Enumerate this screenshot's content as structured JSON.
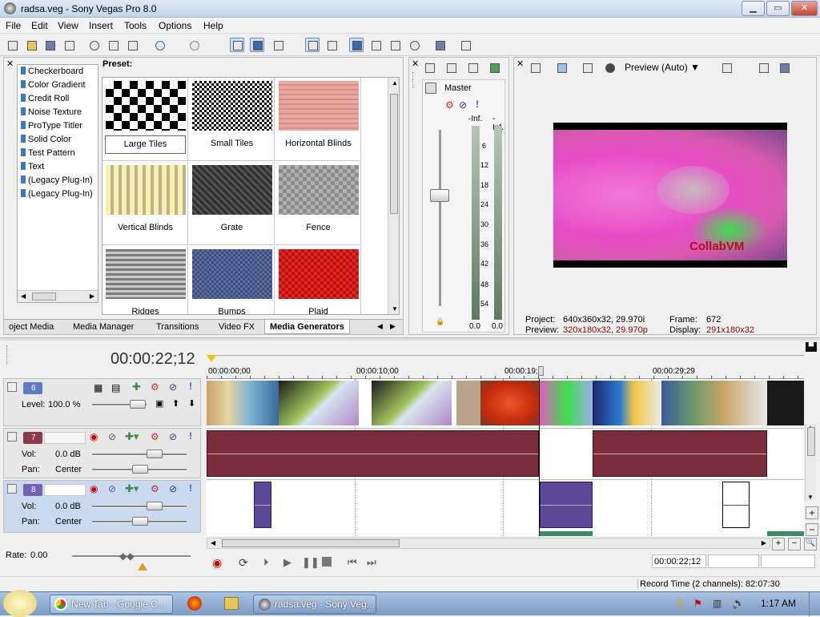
{
  "window": {
    "title": "radsa.veg - Sony Vegas Pro 8.0",
    "min": "▁",
    "max": "▭",
    "close": "✕"
  },
  "menu": [
    "File",
    "Edit",
    "View",
    "Insert",
    "Tools",
    "Options",
    "Help"
  ],
  "generators": {
    "list": [
      "Checkerboard",
      "Color Gradient",
      "Credit Roll",
      "Noise Texture",
      "ProType Titler",
      "Solid Color",
      "Test Pattern",
      "Text",
      "(Legacy Plug-In) T",
      "(Legacy Plug-In) V"
    ],
    "preset_label": "Preset:",
    "presets": [
      "Large Tiles",
      "Small Tiles",
      "Horizontal Blinds",
      "Vertical Blinds",
      "Grate",
      "Fence",
      "Ridges",
      "Bumps",
      "Plaid"
    ]
  },
  "tabs": [
    "oject Media",
    "Media Manager",
    "Transitions",
    "Video FX",
    "Media Generators"
  ],
  "mixer": {
    "label": "Master",
    "peak_left": "-Inf.",
    "peak_right": "-Inf.",
    "scale": [
      "6",
      "12",
      "18",
      "24",
      "30",
      "36",
      "42",
      "48",
      "54"
    ],
    "val_left": "0.0",
    "val_right": "0.0"
  },
  "preview": {
    "mode": "Preview (Auto)",
    "watermark": "CollabVM",
    "project_label": "Project:",
    "project_value": "640x360x32, 29.970i",
    "preview_label": "Preview:",
    "preview_value": "320x180x32, 29.970p",
    "frame_label": "Frame:",
    "frame_value": "672",
    "display_label": "Display:",
    "display_value": "291x180x32",
    "accent_red": "#8b0000"
  },
  "timeline": {
    "timecode": "00:00:22;12",
    "ruler": [
      "00:00:00;00",
      "00:00:10;00",
      "00:00:19;",
      "00:00:29;29"
    ],
    "tracks": [
      {
        "num": "6",
        "color": "#5e7cc4",
        "level_label": "Level:",
        "level_value": "100.0 %"
      },
      {
        "num": "7",
        "color": "#8c3a4b",
        "vol_label": "Vol:",
        "vol_value": "0.0 dB",
        "pan_label": "Pan:",
        "pan_value": "Center"
      },
      {
        "num": "8",
        "color": "#7262b0",
        "vol_label": "Vol:",
        "vol_value": "0.0 dB",
        "pan_label": "Pan:",
        "pan_value": "Center"
      }
    ],
    "rate_label": "Rate:",
    "rate_value": "0.00",
    "cursor_time": "00:00:22;12"
  },
  "status": {
    "record_time": "Record Time (2 channels): 82:07:30"
  },
  "taskbar": {
    "items": [
      "New Tab - Google C...",
      "radsa.veg - Sony Veg..."
    ],
    "clock": "1:17 AM"
  }
}
